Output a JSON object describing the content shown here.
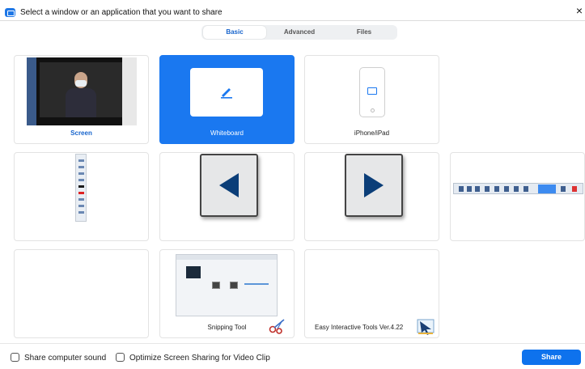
{
  "window": {
    "title": "Select a window or an application that you want to share",
    "close_glyph": "×"
  },
  "tabs": [
    {
      "label": "Basic",
      "active": true
    },
    {
      "label": "Advanced",
      "active": false
    },
    {
      "label": "Files",
      "active": false
    }
  ],
  "tiles": [
    {
      "label": "Screen"
    },
    {
      "label": "Whiteboard"
    },
    {
      "label": "iPhone/iPad"
    },
    {
      "label": ""
    },
    {
      "label": ""
    },
    {
      "label": ""
    },
    {
      "label": ""
    },
    {
      "label": ""
    },
    {
      "label": "Snipping Tool"
    },
    {
      "label": "Easy Interactive Tools Ver.4.22"
    }
  ],
  "footer": {
    "share_sound_label": "Share computer sound",
    "optimize_label": "Optimize Screen Sharing for Video Clip",
    "share_button": "Share"
  },
  "colors": {
    "accent": "#0e72ed",
    "selected_tile": "#1a78f0"
  },
  "icons": [
    "zoom-app-icon",
    "close-icon",
    "pen-icon",
    "airplay-icon",
    "left-arrow-icon",
    "right-arrow-icon",
    "scissors-icon",
    "easy-interactive-icon"
  ]
}
